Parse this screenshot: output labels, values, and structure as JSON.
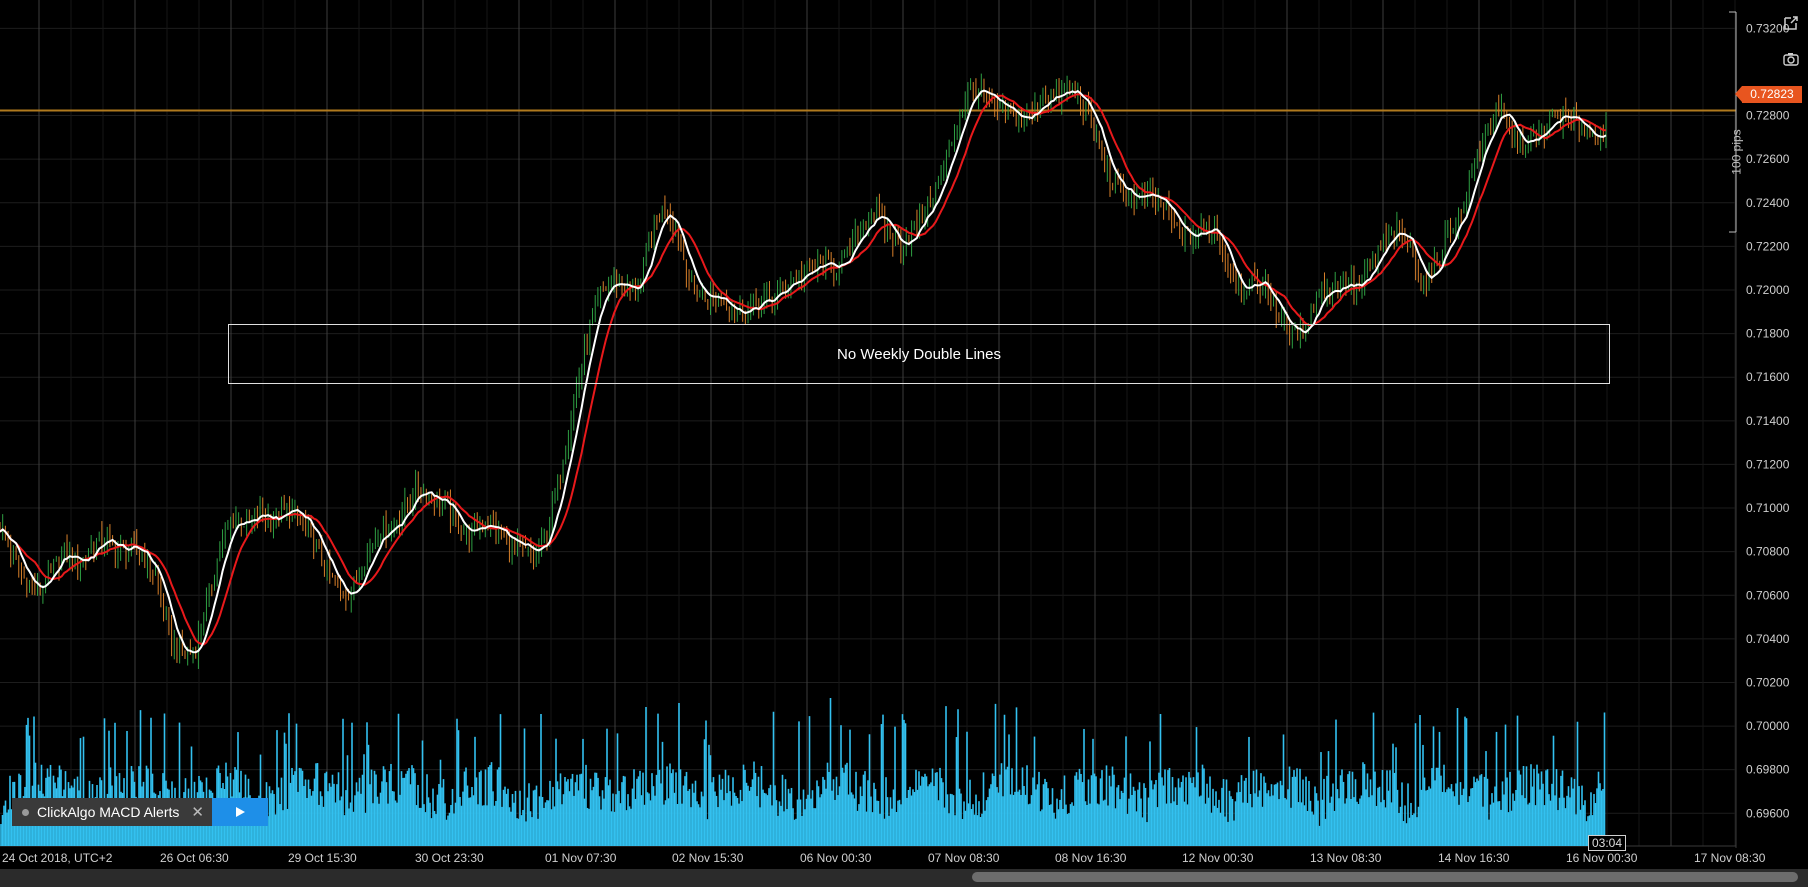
{
  "chart_data": {
    "type": "candlestick",
    "y_axis_ticks": [
      "0.73200",
      "0.72800",
      "0.72600",
      "0.72400",
      "0.72200",
      "0.72000",
      "0.71800",
      "0.71600",
      "0.71400",
      "0.71200",
      "0.71000",
      "0.70800",
      "0.70600",
      "0.70400",
      "0.70200",
      "0.70000",
      "0.69800",
      "0.69600"
    ],
    "ylim": [
      0.6945,
      0.7333
    ],
    "x_axis_ticks": [
      "24 Oct 2018, UTC+2",
      "26 Oct 06:30",
      "29 Oct 15:30",
      "30 Oct 23:30",
      "01 Nov 07:30",
      "02 Nov 15:30",
      "06 Nov 00:30",
      "07 Nov 08:30",
      "08 Nov 16:30",
      "12 Nov 00:30",
      "13 Nov 08:30",
      "14 Nov 16:30",
      "16 Nov 00:30",
      "17 Nov 08:30"
    ],
    "current_price": "0.72823",
    "current_price_value": 0.72823,
    "price_series_approx": [
      0.7092,
      0.7078,
      0.7066,
      0.7062,
      0.7072,
      0.708,
      0.7074,
      0.7082,
      0.7086,
      0.708,
      0.7082,
      0.7078,
      0.7068,
      0.704,
      0.7032,
      0.7036,
      0.706,
      0.7085,
      0.7096,
      0.7092,
      0.7098,
      0.7094,
      0.71,
      0.7094,
      0.7086,
      0.7072,
      0.706,
      0.7062,
      0.7078,
      0.709,
      0.7092,
      0.71,
      0.711,
      0.7106,
      0.7102,
      0.7092,
      0.7088,
      0.7094,
      0.709,
      0.7084,
      0.708,
      0.7078,
      0.709,
      0.712,
      0.715,
      0.7178,
      0.7198,
      0.7205,
      0.72,
      0.7202,
      0.7228,
      0.724,
      0.7222,
      0.7202,
      0.7196,
      0.7198,
      0.7192,
      0.719,
      0.7194,
      0.7195,
      0.7202,
      0.7206,
      0.7208,
      0.7212,
      0.721,
      0.7216,
      0.723,
      0.7236,
      0.7226,
      0.722,
      0.7228,
      0.7238,
      0.725,
      0.727,
      0.729,
      0.7292,
      0.7284,
      0.7282,
      0.7278,
      0.728,
      0.729,
      0.7288,
      0.7292,
      0.7285,
      0.727,
      0.725,
      0.7245,
      0.7242,
      0.7242,
      0.724,
      0.7228,
      0.7224,
      0.7226,
      0.723,
      0.7212,
      0.72,
      0.7204,
      0.72,
      0.7188,
      0.7178,
      0.7184,
      0.72,
      0.72,
      0.7204,
      0.72,
      0.721,
      0.7222,
      0.7226,
      0.722,
      0.7202,
      0.7212,
      0.7228,
      0.7236,
      0.726,
      0.7276,
      0.7282,
      0.7268,
      0.7268,
      0.727,
      0.728,
      0.7278,
      0.7276,
      0.727,
      0.7274
    ],
    "ma_fast_color": "#ffffff",
    "ma_slow_color": "#e8191b",
    "volume_color": "#33c1f0",
    "horizontal_line_color": "#b07a1e",
    "grid": true
  },
  "annotation": {
    "text": "No Weekly Double Lines"
  },
  "pips_label": "100 pips",
  "price_badge": "0.72823",
  "time_badge": "03:04",
  "algo": {
    "label": "ClickAlgo MACD Alerts",
    "close": "✕"
  },
  "icons": {
    "popout": "popout-icon",
    "snapshot": "camera-icon",
    "play": "play-icon"
  }
}
